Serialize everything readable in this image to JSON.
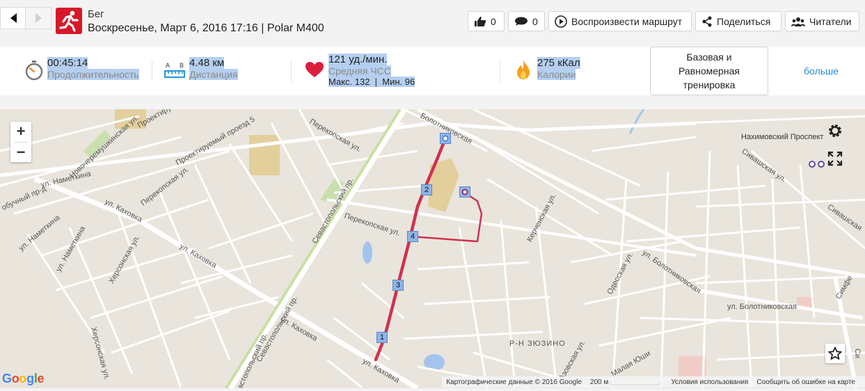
{
  "header": {
    "sport": "Бег",
    "subtitle": "Воскресенье, Март 6, 2016 17:16 | Polar M400",
    "buttons": {
      "likes": "0",
      "comments": "0",
      "replay": "Воспроизвести маршрут",
      "share": "Поделиться",
      "followers": "Читатели"
    }
  },
  "stats": {
    "duration": {
      "value": "00:45:14",
      "label": "Продолжительность"
    },
    "distance": {
      "value": "4.48 км",
      "label": "Дистанция",
      "icon_text_a": "A",
      "icon_text_b": "B"
    },
    "heart_rate": {
      "value": "121 уд./мин.",
      "label": "Средняя ЧСС",
      "extra": "Макс. 132  |  Мин. 96"
    },
    "calories": {
      "value": "275 кКал",
      "label": "Калории"
    },
    "training_benefit": "Базовая и Равномерная тренировка",
    "more": "больше"
  },
  "map": {
    "street_labels": {
      "bolotnikovskaya": "ул. Болотниковская",
      "bolotnikovskaya_2": "ул. Болотниковская",
      "bolotnikovskaya_3": "ул. Болотниковская",
      "bolotnikovskaya_top": "Болотниковская",
      "perekopskaya_1": "Перекопская ул.",
      "perekopskaya_2": "Перекопская ул.",
      "perekopskaya_3": "Перекопская ул.",
      "sevastopolsky_1": "Севастопольский пр.",
      "sevastopolsky_2": "Севастопольский пр.",
      "sevastopolsky_3": "Севастопольский пр.",
      "kakhovka_1": "ул. Каховка",
      "kakhovka_2": "ул. Каховка",
      "kakhovka_3": "ул. Каховка",
      "kakhovka_4": "ул. Каховка",
      "nametkina_1": "ул. Наметкина",
      "nametkina_2": "ул. Наметкина",
      "nametkina_3": "ул. Наметкина",
      "novocheremushkinskaya": "Новочеремушкинская ул.",
      "khersonskaya_1": "Херсонская ул.",
      "khersonskaya_2": "Херсонская ул.",
      "kerchenskaya": "Керченская ул.",
      "odesskaya": "Одесская ул.",
      "sivashskaya_1": "Сивашская ул.",
      "sivashskaya_2": "Сивашская",
      "proektiruemy_1": "Проектируемый проезд 5",
      "proektiruemy_2": "Проектиру",
      "nakhimovsky": "Нахимовский Проспект",
      "zyuzino": "Р-Н ЗЮЗИНО",
      "malaya": "Малая Юши",
      "simferopolsky": "Симфе",
      "obuchny": "обучный пр-д",
      "azovskaya": "Азовская ул.",
      "si": "Си"
    },
    "markers": [
      "1",
      "2",
      "3",
      "4"
    ],
    "google": "Google",
    "footer": {
      "copyright": "Картографические данные © 2016 Google",
      "scale": "200 м",
      "terms": "Условия использования",
      "report": "Сообщить об ошибке на карте"
    },
    "route_color": "#d0304f"
  }
}
